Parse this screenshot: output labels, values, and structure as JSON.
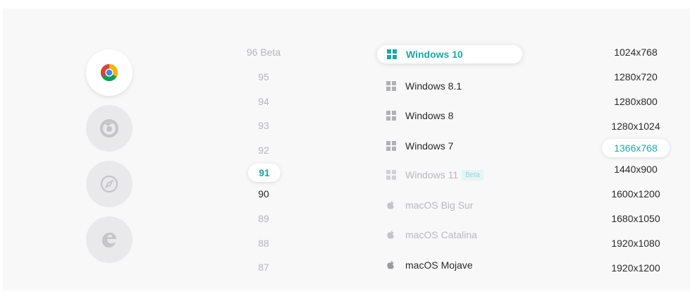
{
  "browsers": [
    {
      "icon": "chrome-icon",
      "active": true
    },
    {
      "icon": "firefox-icon",
      "active": false
    },
    {
      "icon": "safari-icon",
      "active": false
    },
    {
      "icon": "edge-icon",
      "active": false
    }
  ],
  "versions": [
    "96 Beta",
    "95",
    "94",
    "93",
    "92",
    "91",
    "90",
    "89",
    "88",
    "87"
  ],
  "selected_version": "91",
  "os_list": [
    {
      "label": "Windows 10",
      "icon": "windows-icon"
    },
    {
      "label": "Windows 8.1",
      "icon": "windows-icon"
    },
    {
      "label": "Windows 8",
      "icon": "windows-icon"
    },
    {
      "label": "Windows 7",
      "icon": "windows-icon"
    },
    {
      "label": "Windows 11",
      "icon": "windows-icon",
      "badge": "Beta"
    },
    {
      "label": "macOS Big Sur",
      "icon": "apple-icon"
    },
    {
      "label": "macOS Catalina",
      "icon": "apple-icon"
    },
    {
      "label": "macOS Mojave",
      "icon": "apple-icon"
    }
  ],
  "selected_os": "Windows 10",
  "resolutions": [
    "1024x768",
    "1280x720",
    "1280x800",
    "1280x1024",
    "1366x768",
    "1440x900",
    "1600x1200",
    "1680x1050",
    "1920x1080",
    "1920x1200"
  ],
  "selected_resolution": "1366x768",
  "colors": {
    "accent": "#1ba8a8",
    "muted": "#b6b6bb",
    "text": "#2a2a2a",
    "panel": "#f8f8f9"
  }
}
